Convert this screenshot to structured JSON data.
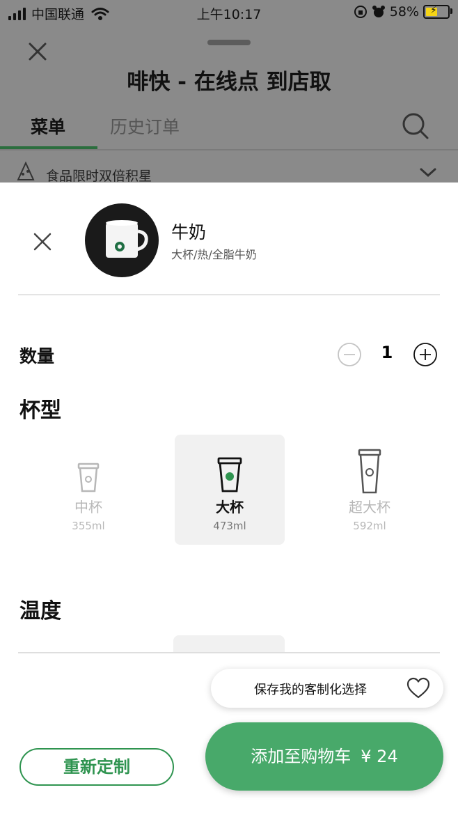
{
  "status_bar": {
    "carrier": "中国联通",
    "time": "上午10:17",
    "battery": "58%"
  },
  "background": {
    "title": "啡快 - 在线点 到店取",
    "tabs": [
      {
        "label": "菜单",
        "active": true
      },
      {
        "label": "历史订单",
        "active": false
      }
    ],
    "promo": "食品限时双倍积星"
  },
  "product": {
    "name": "牛奶",
    "description": "大杯/热/全脂牛奶"
  },
  "quantity": {
    "label": "数量",
    "value": "1"
  },
  "cup_size": {
    "title": "杯型",
    "options": [
      {
        "name": "中杯",
        "volume": "355ml",
        "selected": false
      },
      {
        "name": "大杯",
        "volume": "473ml",
        "selected": true
      },
      {
        "name": "超大杯",
        "volume": "592ml",
        "selected": false
      }
    ]
  },
  "temperature": {
    "title": "温度"
  },
  "save_choice": {
    "label": "保存我的客制化选择"
  },
  "actions": {
    "restart_label": "重新定制",
    "add_to_cart_label": "添加至购物车",
    "price": "¥ 24"
  },
  "colors": {
    "accent": "#48a96a",
    "accent_dark": "#2f9450",
    "tab_underline": "#2b6e3e"
  },
  "icons": {
    "close": "close-icon",
    "search": "search-icon",
    "minus": "minus-circle-icon",
    "plus": "plus-circle-icon",
    "heart": "heart-icon",
    "cup": "cup-icon",
    "chevron": "chevron-down-icon"
  }
}
